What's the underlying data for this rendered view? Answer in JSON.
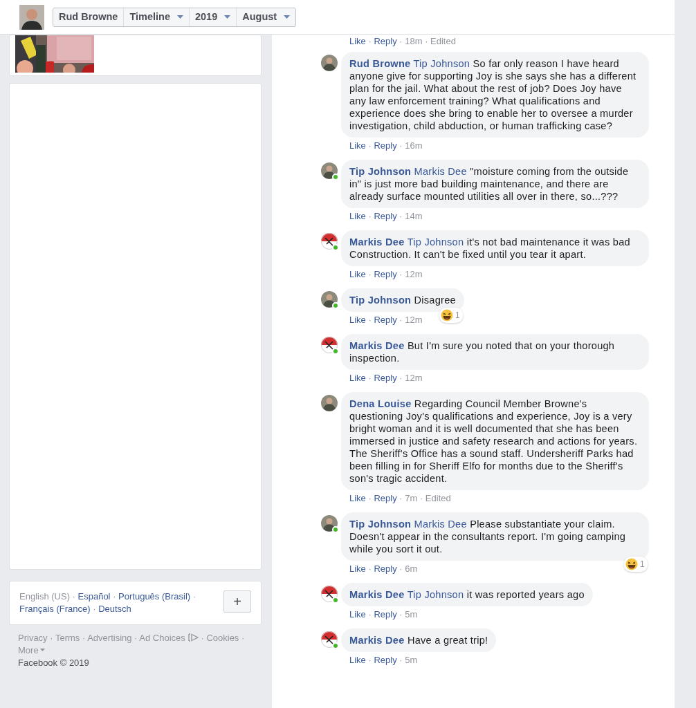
{
  "top_bar": {
    "crumbs": [
      {
        "label": "Rud Browne",
        "dropdown": false
      },
      {
        "label": "Timeline",
        "dropdown": true
      },
      {
        "label": "2019",
        "dropdown": true
      },
      {
        "label": "August",
        "dropdown": true
      }
    ]
  },
  "separator": "·",
  "languages": {
    "current": "English (US)",
    "others": [
      "Español",
      "Português (Brasil)",
      "Français (France)",
      "Deutsch"
    ],
    "more_button": "+"
  },
  "footer": {
    "links": [
      "Privacy",
      "Terms",
      "Advertising",
      "Ad Choices",
      "Cookies",
      "More"
    ],
    "copyright": "Facebook © 2019"
  },
  "previous_actions": {
    "like": "Like",
    "reply": "Reply",
    "time": "18m",
    "edited": "Edited"
  },
  "comments": [
    {
      "author": "Rud Browne",
      "mention": "Tip Johnson",
      "text": "So far only reason I have heard anyone give for supporting Joy is she says she has a different plan for the jail. What about the rest of job? Does Joy have any law enforcement training? What qualifications and experience does she bring to enable her to oversee a murder investigation, child abduction, or human trafficking case?",
      "online": false,
      "like": "Like",
      "reply": "Reply",
      "time": "16m"
    },
    {
      "author": "Tip Johnson",
      "mention": "Markis Dee",
      "text": "\"moisture coming from the outside in\" is just more bad building maintenance, and there are already surface mounted utilities all over in there, so...???",
      "online": true,
      "like": "Like",
      "reply": "Reply",
      "time": "14m"
    },
    {
      "author": "Markis Dee",
      "mention": "Tip Johnson",
      "text": "it's not bad maintenance it was bad Construction. It can't be fixed until you tear it apart.",
      "kind": "emblem",
      "online": true,
      "like": "Like",
      "reply": "Reply",
      "time": "12m"
    },
    {
      "author": "Tip Johnson",
      "text": "Disagree",
      "online": true,
      "like": "Like",
      "reply": "Reply",
      "time": "12m",
      "reactions": "1"
    },
    {
      "author": "Markis Dee",
      "text": "But I'm sure you noted that on your thorough inspection.",
      "kind": "emblem",
      "online": true,
      "like": "Like",
      "reply": "Reply",
      "time": "12m"
    },
    {
      "author": "Dena Louise",
      "text": "Regarding Council Member Browne's questioning Joy's qualifications and experience, Joy is a very bright woman and it is well documented that she has been immersed in justice and safety research and actions for years. The Sheriff's Office has a sound staff. Undersheriff Parks had been filling in for Sheriff Elfo for months due to the Sheriff's son's tragic accident.",
      "online": false,
      "like": "Like",
      "reply": "Reply",
      "time": "7m",
      "edited": "Edited"
    },
    {
      "author": "Tip Johnson",
      "mention": "Markis Dee",
      "text": "Please substantiate your claim. Doesn't appear in the consultants report. I'm going camping while you sort it out.",
      "online": true,
      "like": "Like",
      "reply": "Reply",
      "time": "6m",
      "reactions": "1"
    },
    {
      "author": "Markis Dee",
      "mention": "Tip Johnson",
      "text": "it was reported years ago",
      "kind": "emblem",
      "online": true,
      "like": "Like",
      "reply": "Reply",
      "time": "5m"
    },
    {
      "author": "Markis Dee",
      "text": "Have a great trip!",
      "kind": "emblem",
      "online": true,
      "like": "Like",
      "reply": "Reply",
      "time": "5m"
    }
  ]
}
